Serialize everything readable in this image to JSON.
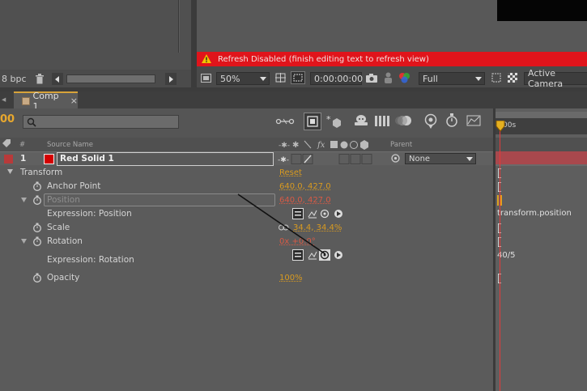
{
  "project_panel": {
    "bpc_label": "8 bpc"
  },
  "viewer": {
    "warning_text": "Refresh Disabled (finish editing text to refresh view)",
    "zoom": "50%",
    "timecode": "0:00:00:00",
    "resolution": "Full",
    "camera": "Active Camera"
  },
  "timeline": {
    "tab_label": "Comp 1",
    "current_time": "00",
    "ruler_label": "00s",
    "columns": {
      "number": "#",
      "source_name": "Source Name",
      "parent": "Parent"
    },
    "layer": {
      "number": "1",
      "name": "Red Solid 1",
      "color": "#d40000",
      "label_color": "#b83a3a",
      "parent": "None"
    },
    "properties": {
      "transform_label": "Transform",
      "transform_reset": "Reset",
      "anchor_label": "Anchor Point",
      "anchor_value": "640.0, 427.0",
      "position_label": "Position",
      "position_value": "640.0, 427.0",
      "expr_position_label": "Expression: Position",
      "scale_label": "Scale",
      "scale_value": "34.4, 34.4%",
      "rotation_label": "Rotation",
      "rotation_value": "0x +0.0°",
      "expr_rotation_label": "Expression: Rotation",
      "opacity_label": "Opacity",
      "opacity_value": "100%"
    },
    "expressions": {
      "position": "transform.position",
      "rotation": "40/5"
    }
  },
  "colors": {
    "accent": "#d89a20",
    "warning": "#e0141b",
    "playhead": "#e33a3a"
  }
}
